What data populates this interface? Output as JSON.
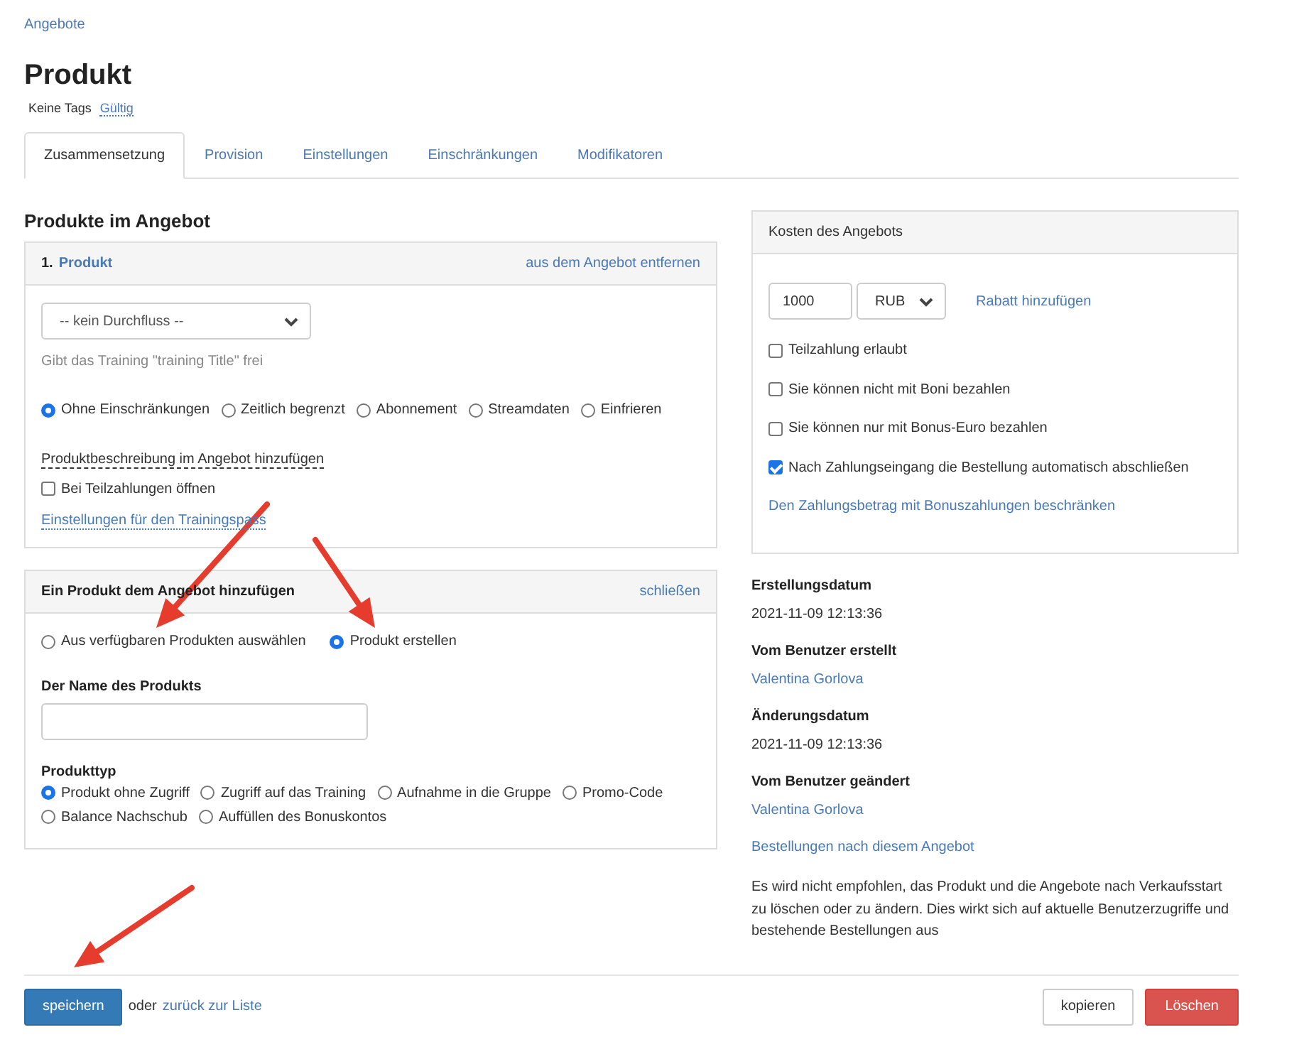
{
  "breadcrumb": "Angebote",
  "title": "Produkt",
  "tags": {
    "label": "Keine Tags",
    "status": "Gültig"
  },
  "tabs": [
    {
      "label": "Zusammensetzung",
      "selected": true
    },
    {
      "label": "Provision",
      "selected": false
    },
    {
      "label": "Einstellungen",
      "selected": false
    },
    {
      "label": "Einschränkungen",
      "selected": false
    },
    {
      "label": "Modifikatoren",
      "selected": false
    }
  ],
  "products_section": {
    "heading": "Produkte im Angebot",
    "product": {
      "number": "1.",
      "name": "Produkt",
      "remove_link": "aus dem Angebot entfernen",
      "flow_select": "-- kein Durchfluss --",
      "hint": "Gibt das Training \"training Title\" frei",
      "access_options": [
        {
          "label": "Ohne Einschränkungen",
          "selected": true
        },
        {
          "label": "Zeitlich begrenzt",
          "selected": false
        },
        {
          "label": "Abonnement",
          "selected": false
        },
        {
          "label": "Streamdaten",
          "selected": false
        },
        {
          "label": "Einfrieren",
          "selected": false
        }
      ],
      "description_link": "Produktbeschreibung im Angebot hinzufügen",
      "installment_checkbox": {
        "label": "Bei Teilzahlungen öffnen",
        "checked": false
      },
      "pass_settings_link": "Einstellungen für den Trainingspass"
    }
  },
  "add_product": {
    "title": "Ein Produkt dem Angebot hinzufügen",
    "close_link": "schließen",
    "modes": [
      {
        "label": "Aus verfügbaren Produkten auswählen",
        "selected": false
      },
      {
        "label": "Produkt erstellen",
        "selected": true
      }
    ],
    "name_label": "Der Name des Produkts",
    "type_label": "Produkttyp",
    "types": [
      {
        "label": "Produkt ohne Zugriff",
        "selected": true
      },
      {
        "label": "Zugriff auf das Training",
        "selected": false
      },
      {
        "label": "Aufnahme in die Gruppe",
        "selected": false
      },
      {
        "label": "Promo-Code",
        "selected": false
      },
      {
        "label": "Balance Nachschub",
        "selected": false
      },
      {
        "label": "Auffüllen des Bonuskontos",
        "selected": false
      }
    ]
  },
  "cost": {
    "title": "Kosten des Angebots",
    "amount": "1000",
    "currency": "RUB",
    "discount_link": "Rabatt hinzufügen",
    "options": [
      {
        "label": "Teilzahlung erlaubt",
        "checked": false
      },
      {
        "label": "Sie können nicht mit Boni bezahlen",
        "checked": false
      },
      {
        "label": "Sie können nur mit Bonus-Euro bezahlen",
        "checked": false
      },
      {
        "label": "Nach Zahlungseingang die Bestellung automatisch abschließen",
        "checked": true
      }
    ],
    "limit_link": "Den Zahlungsbetrag mit Bonuszahlungen beschränken"
  },
  "meta": [
    {
      "label": "Erstellungsdatum",
      "value": "2021-11-09 12:13:36",
      "kind": "text"
    },
    {
      "label": "Vom Benutzer erstellt",
      "value": "Valentina Gorlova",
      "kind": "link"
    },
    {
      "label": "Änderungsdatum",
      "value": "2021-11-09 12:13:36",
      "kind": "text"
    },
    {
      "label": "Vom Benutzer geändert",
      "value": "Valentina Gorlova",
      "kind": "link"
    }
  ],
  "orders_link": "Bestellungen nach diesem Angebot",
  "warning": "Es wird nicht empfohlen, das Produkt und die Angebote nach Verkaufsstart zu löschen oder zu ändern. Dies wirkt sich auf aktuelle Benutzerzugriffe und bestehende Bestellungen aus",
  "footer": {
    "save": "speichern",
    "or": "oder",
    "back_link": "zurück zur Liste",
    "copy": "kopieren",
    "delete": "Löschen"
  },
  "annotations": [
    {
      "kind": "arrow"
    },
    {
      "kind": "arrow"
    },
    {
      "kind": "arrow"
    }
  ]
}
